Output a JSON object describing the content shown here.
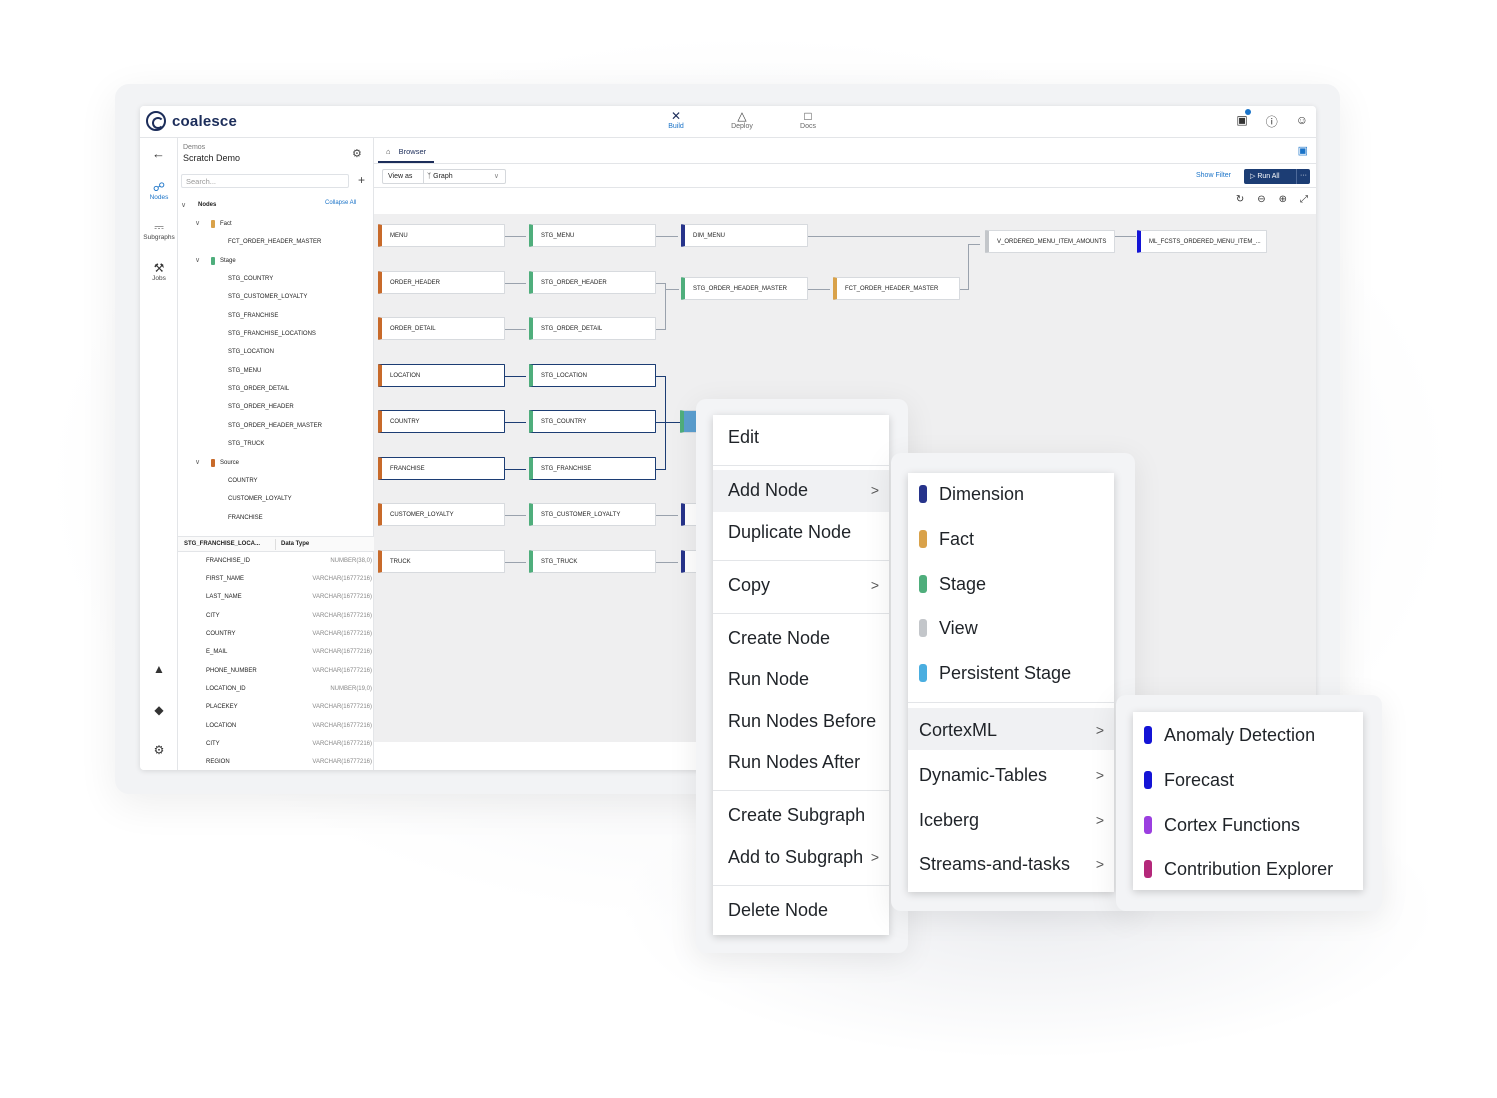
{
  "app": {
    "logo_text": "coalesce",
    "nav": [
      {
        "label": "Build",
        "icon": "build-icon",
        "active": true
      },
      {
        "label": "Deploy",
        "icon": "deploy-icon",
        "active": false
      },
      {
        "label": "Docs",
        "icon": "docs-icon",
        "active": false
      }
    ],
    "accent_color": "#1c3d74",
    "link_color": "#1a73c8"
  },
  "rail": {
    "items": [
      {
        "label": "Nodes",
        "icon": "nodes-icon"
      },
      {
        "label": "Subgraphs",
        "icon": "subgraphs-icon"
      },
      {
        "label": "Jobs",
        "icon": "jobs-icon"
      }
    ]
  },
  "project": {
    "group": "Demos",
    "name": "Scratch Demo",
    "search_placeholder": "Search..."
  },
  "tree": {
    "root": "Nodes",
    "collapse_all": "Collapse All",
    "groups": [
      {
        "label": "Fact",
        "color": "#d9a24a",
        "items": [
          "FCT_ORDER_HEADER_MASTER"
        ]
      },
      {
        "label": "Stage",
        "color": "#4fae7c",
        "items": [
          "STG_COUNTRY",
          "STG_CUSTOMER_LOYALTY",
          "STG_FRANCHISE",
          "STG_FRANCHISE_LOCATIONS",
          "STG_LOCATION",
          "STG_MENU",
          "STG_ORDER_DETAIL",
          "STG_ORDER_HEADER",
          "STG_ORDER_HEADER_MASTER",
          "STG_TRUCK"
        ]
      },
      {
        "label": "Source",
        "color": "#c86a2a",
        "items": [
          "COUNTRY",
          "CUSTOMER_LOYALTY",
          "FRANCHISE"
        ]
      }
    ]
  },
  "columns": {
    "header_name": "STG_FRANCHISE_LOCA...",
    "header_type": "Data Type",
    "rows": [
      {
        "name": "FRANCHISE_ID",
        "type": "NUMBER(38,0)"
      },
      {
        "name": "FIRST_NAME",
        "type": "VARCHAR(16777216)"
      },
      {
        "name": "LAST_NAME",
        "type": "VARCHAR(16777216)"
      },
      {
        "name": "CITY",
        "type": "VARCHAR(16777216)"
      },
      {
        "name": "COUNTRY",
        "type": "VARCHAR(16777216)"
      },
      {
        "name": "E_MAIL",
        "type": "VARCHAR(16777216)"
      },
      {
        "name": "PHONE_NUMBER",
        "type": "VARCHAR(16777216)"
      },
      {
        "name": "LOCATION_ID",
        "type": "NUMBER(19,0)"
      },
      {
        "name": "PLACEKEY",
        "type": "VARCHAR(16777216)"
      },
      {
        "name": "LOCATION",
        "type": "VARCHAR(16777216)"
      },
      {
        "name": "CITY",
        "type": "VARCHAR(16777216)"
      },
      {
        "name": "REGION",
        "type": "VARCHAR(16777216)"
      }
    ]
  },
  "browser": {
    "tab_label": "Browser",
    "view_as_label": "View as",
    "view_value": "Graph",
    "show_filter": "Show Filter",
    "run_all": "Run All",
    "run_all_more": "···"
  },
  "graph": {
    "nodes": [
      {
        "label": "MENU",
        "color": "#c86a2a"
      },
      {
        "label": "STG_MENU",
        "color": "#4fae7c"
      },
      {
        "label": "DIM_MENU",
        "color": "#27348b"
      },
      {
        "label": "V_ORDERED_MENU_ITEM_AMOUNTS",
        "color": "#c3c6ca"
      },
      {
        "label": "ML_FCSTS_ORDERED_MENU_ITEM_...",
        "color": "#1414d6"
      },
      {
        "label": "ORDER_HEADER",
        "color": "#c86a2a"
      },
      {
        "label": "STG_ORDER_HEADER",
        "color": "#4fae7c"
      },
      {
        "label": "STG_ORDER_HEADER_MASTER",
        "color": "#4fae7c"
      },
      {
        "label": "FCT_ORDER_HEADER_MASTER",
        "color": "#d9a24a"
      },
      {
        "label": "ORDER_DETAIL",
        "color": "#c86a2a"
      },
      {
        "label": "STG_ORDER_DETAIL",
        "color": "#4fae7c"
      },
      {
        "label": "LOCATION",
        "color": "#c86a2a"
      },
      {
        "label": "STG_LOCATION",
        "color": "#4fae7c"
      },
      {
        "label": "COUNTRY",
        "color": "#c86a2a"
      },
      {
        "label": "STG_COUNTRY",
        "color": "#4fae7c"
      },
      {
        "label": "FRANCHISE",
        "color": "#c86a2a"
      },
      {
        "label": "STG_FRANCHISE",
        "color": "#4fae7c"
      },
      {
        "label": "CUSTOMER_LOYALTY",
        "color": "#c86a2a"
      },
      {
        "label": "STG_CUSTOMER_LOYALTY",
        "color": "#4fae7c"
      },
      {
        "label": "TRUCK",
        "color": "#c86a2a"
      },
      {
        "label": "STG_TRUCK",
        "color": "#4fae7c"
      }
    ]
  },
  "context_menu": {
    "items": [
      "Edit",
      "Add Node",
      "Duplicate Node",
      "Copy",
      "Create Node",
      "Run Node",
      "Run Nodes Before",
      "Run Nodes After",
      "Create Subgraph",
      "Add to Subgraph",
      "Delete Node"
    ]
  },
  "add_node_menu": {
    "types": [
      {
        "label": "Dimension",
        "color": "#27348b"
      },
      {
        "label": "Fact",
        "color": "#d9a24a"
      },
      {
        "label": "Stage",
        "color": "#4fae7c"
      },
      {
        "label": "View",
        "color": "#c3c6ca"
      },
      {
        "label": "Persistent Stage",
        "color": "#4aaee0"
      }
    ],
    "packages": [
      "CortexML",
      "Dynamic-Tables",
      "Iceberg",
      "Streams-and-tasks"
    ]
  },
  "cortex_menu": {
    "items": [
      {
        "label": "Anomaly Detection",
        "color": "#1414d6"
      },
      {
        "label": "Forecast",
        "color": "#1414d6"
      },
      {
        "label": "Cortex Functions",
        "color": "#9b3fe0"
      },
      {
        "label": "Contribution Explorer",
        "color": "#b4287a"
      }
    ]
  }
}
